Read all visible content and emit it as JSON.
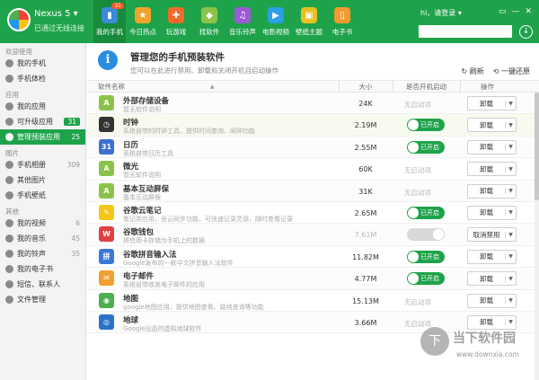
{
  "device": {
    "name": "Nexus 5 ▾",
    "status": "已通过无线连接"
  },
  "nav": [
    {
      "label": "我的手机",
      "badge": "31",
      "color": "#3b8ad8",
      "icon": "phone-icon",
      "glyph": "▮",
      "active": true
    },
    {
      "label": "今日热点",
      "color": "#f2a32a",
      "icon": "star-icon",
      "glyph": "★"
    },
    {
      "label": "玩游戏",
      "color": "#f06a2a",
      "icon": "gamepad-icon",
      "glyph": "✚"
    },
    {
      "label": "找软件",
      "color": "#8bc34a",
      "icon": "android-icon",
      "glyph": "◆"
    },
    {
      "label": "音乐铃声",
      "color": "#9c5ad6",
      "icon": "music-icon",
      "glyph": "♫"
    },
    {
      "label": "电影视频",
      "color": "#2aa0e6",
      "icon": "play-icon",
      "glyph": "▶"
    },
    {
      "label": "壁纸主题",
      "color": "#e8c020",
      "icon": "wallpaper-icon",
      "glyph": "▣"
    },
    {
      "label": "电子书",
      "color": "#f29a2e",
      "icon": "book-icon",
      "glyph": "▯"
    }
  ],
  "user": "hi，请登录 ▾",
  "window_controls": [
    "▭",
    "—",
    "✕"
  ],
  "search": {
    "placeholder": ""
  },
  "sidebar": [
    {
      "section": "欢迎使用"
    },
    {
      "label": "我的手机",
      "icon": "phone-icon"
    },
    {
      "label": "手机体检",
      "icon": "checkup-icon"
    },
    {
      "section": "应用"
    },
    {
      "label": "我的应用",
      "icon": "apps-icon"
    },
    {
      "label": "可升级应用",
      "icon": "upgrade-icon",
      "count": "31",
      "badge": true
    },
    {
      "label": "管理预装应用",
      "icon": "preinstalled-icon",
      "count": "25",
      "active": true
    },
    {
      "section": "图片"
    },
    {
      "label": "手机相册",
      "icon": "album-icon",
      "count": "309"
    },
    {
      "label": "其他图片",
      "icon": "image-icon"
    },
    {
      "label": "手机壁纸",
      "icon": "wallpaper-icon"
    },
    {
      "section": "其他"
    },
    {
      "label": "我的视频",
      "icon": "video-icon",
      "count": "6"
    },
    {
      "label": "我的音乐",
      "icon": "music-icon",
      "count": "45"
    },
    {
      "label": "我的铃声",
      "icon": "ringtone-icon",
      "count": "35"
    },
    {
      "label": "我的电子书",
      "icon": "ebook-icon"
    },
    {
      "label": "短信、联系人",
      "icon": "sms-icon"
    },
    {
      "label": "文件管理",
      "icon": "folder-icon"
    }
  ],
  "header": {
    "title": "管理您的手机预装软件",
    "subtitle": "您可以在此进行禁用、卸载和关闭开机自启动操作",
    "refresh": "刷新",
    "restore": "一键还原"
  },
  "columns": {
    "name": "软件名称",
    "size": "大小",
    "autostart": "是否开机启动",
    "action": "操作"
  },
  "apps": [
    {
      "name": "外部存储设备",
      "desc": "暂无软件说明",
      "size": "24K",
      "autostart": "无启动项",
      "toggle": null,
      "action": "卸载",
      "color": "#8bc34a",
      "glyph": "A"
    },
    {
      "name": "时钟",
      "desc": "系统自带的时钟工具，提供时间查询、闹钟功能",
      "size": "2.19M",
      "autostart": "已开启",
      "toggle": "on",
      "action": "卸载",
      "color": "#333333",
      "glyph": "◷",
      "highlight": true
    },
    {
      "name": "日历",
      "desc": "系统自带日历工具",
      "size": "2.55M",
      "autostart": "已开启",
      "toggle": "on",
      "action": "卸载",
      "color": "#3f6fd0",
      "glyph": "31"
    },
    {
      "name": "微光",
      "desc": "暂无软件说明",
      "size": "60K",
      "autostart": "无启动项",
      "toggle": null,
      "action": "卸载",
      "color": "#8bc34a",
      "glyph": "A"
    },
    {
      "name": "基本互动屏保",
      "desc": "基本互动屏保",
      "size": "31K",
      "autostart": "无启动项",
      "toggle": null,
      "action": "卸载",
      "color": "#8bc34a",
      "glyph": "A"
    },
    {
      "name": "谷歌云笔记",
      "desc": "笔记类应用，含云同步功能，可快速记录灵感，随时查看记录",
      "size": "2.65M",
      "autostart": "已开启",
      "toggle": "on",
      "action": "卸载",
      "color": "#f5c518",
      "glyph": "✎"
    },
    {
      "name": "谷歌钱包",
      "desc": "将信用卡存储为手机上的数据",
      "size": "7.61M",
      "autostart": "",
      "toggle": "disabled",
      "action": "取消禁用",
      "color": "#e04040",
      "glyph": "W",
      "dim": true
    },
    {
      "name": "谷歌拼音输入法",
      "desc": "Google发布的一款中文拼音输入法软件",
      "size": "11.82M",
      "autostart": "已开启",
      "toggle": "on",
      "action": "卸载",
      "color": "#3a78d8",
      "glyph": "拼"
    },
    {
      "name": "电子邮件",
      "desc": "系统自带收发电子邮件的应用",
      "size": "4.77M",
      "autostart": "已开启",
      "toggle": "on",
      "action": "卸载",
      "color": "#f0a030",
      "glyph": "✉"
    },
    {
      "name": "地图",
      "desc": "google地图应用，提供地图查看、路线查询等功能",
      "size": "15.13M",
      "autostart": "无启动项",
      "toggle": null,
      "action": "卸载",
      "color": "#4caf50",
      "glyph": "◉"
    },
    {
      "name": "地球",
      "desc": "Google出品的虚拟地球软件",
      "size": "3.66M",
      "autostart": "无启动项",
      "toggle": null,
      "action": "卸载",
      "color": "#2a72c8",
      "glyph": "◎"
    }
  ],
  "watermark": {
    "text": "当下软件园",
    "url": "www.downxia.com",
    "glyph": "下"
  }
}
